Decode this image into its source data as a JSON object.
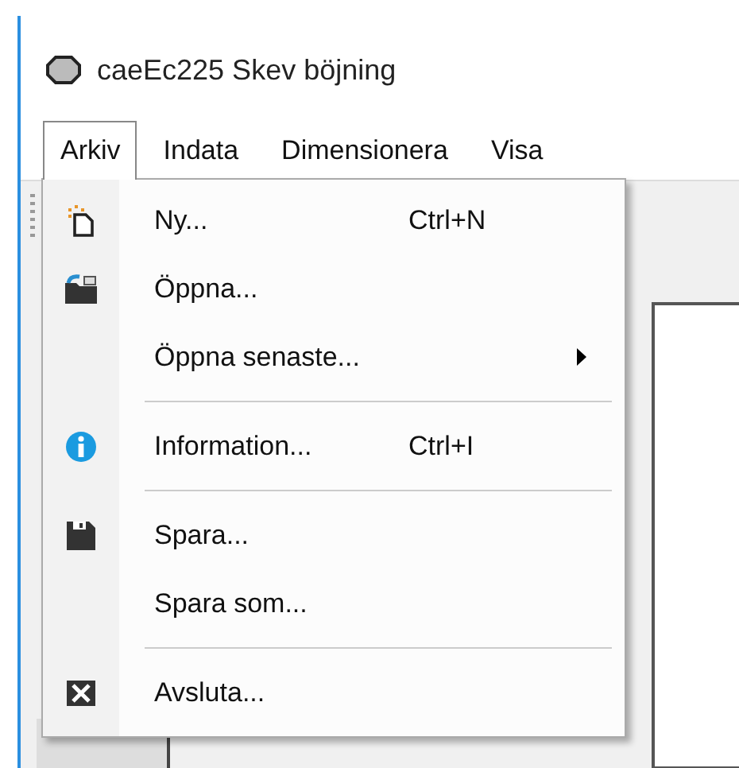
{
  "window": {
    "title": "caeEc225 Skev böjning"
  },
  "menubar": [
    {
      "label": "Arkiv",
      "selected": true
    },
    {
      "label": "Indata",
      "selected": false
    },
    {
      "label": "Dimensionera",
      "selected": false
    },
    {
      "label": "Visa",
      "selected": false
    }
  ],
  "menu": [
    {
      "kind": "item",
      "label": "Ny...",
      "shortcut": "Ctrl+N",
      "submenu": false
    },
    {
      "kind": "item",
      "label": "Öppna...",
      "submenu": false
    },
    {
      "kind": "item",
      "label": "Öppna senaste...",
      "submenu": true
    },
    {
      "kind": "separator"
    },
    {
      "kind": "item",
      "label": "Information...",
      "shortcut": "Ctrl+I",
      "submenu": false
    },
    {
      "kind": "separator"
    },
    {
      "kind": "item",
      "label": "Spara...",
      "submenu": false
    },
    {
      "kind": "item",
      "label": "Spara som...",
      "submenu": false
    },
    {
      "kind": "separator"
    },
    {
      "kind": "item",
      "label": "Avsluta...",
      "submenu": false
    }
  ]
}
